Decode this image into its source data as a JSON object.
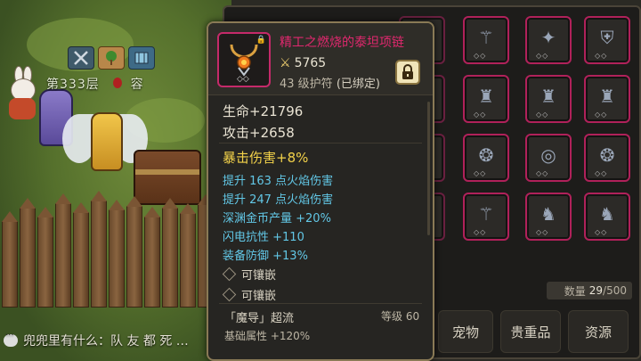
{
  "hud": {
    "floor_text": "第333层",
    "boss_text": "容",
    "icons": [
      "crossed-swords-icon",
      "tree-icon",
      "map-icon"
    ]
  },
  "chat": {
    "message": "兜兜里有什么：队 友 都 死 …"
  },
  "inventory": {
    "count_label": "数量",
    "count_current": "29",
    "count_max": "/500",
    "tabs": [
      "宠物",
      "贵重品",
      "资源"
    ],
    "slot_icons": [
      "staff-icon",
      "mace-icon",
      "chest-armor-icon",
      "robe-icon",
      "robe-icon",
      "robe-icon",
      "necklace-icon",
      "ring-icon",
      "necklace-icon",
      "staff-icon",
      "boots-icon",
      "boots-icon"
    ]
  },
  "tooltip": {
    "item_name": "精工之燃烧的泰坦项链",
    "power": "5765",
    "sub_line": "43 级护符",
    "bound": "(已绑定)",
    "stats": {
      "hp": "生命+21796",
      "atk": "攻击+2658",
      "crit": "暴击伤害+8%"
    },
    "bonuses": [
      "提升 163 点火焰伤害",
      "提升 247 点火焰伤害",
      "深渊金币产量 +20%",
      "闪电抗性 +110",
      "装备防御 +13%"
    ],
    "sockets": [
      "可镶嵌",
      "可镶嵌"
    ],
    "set_name": "「魔导」超流",
    "set_level": "等级 60",
    "set_base": "基础属性 +120%"
  },
  "colors": {
    "item_name": "#e0286e",
    "crit": "#f3d24a",
    "bonus": "#62c7e6",
    "slot_border": "#b0215a"
  }
}
